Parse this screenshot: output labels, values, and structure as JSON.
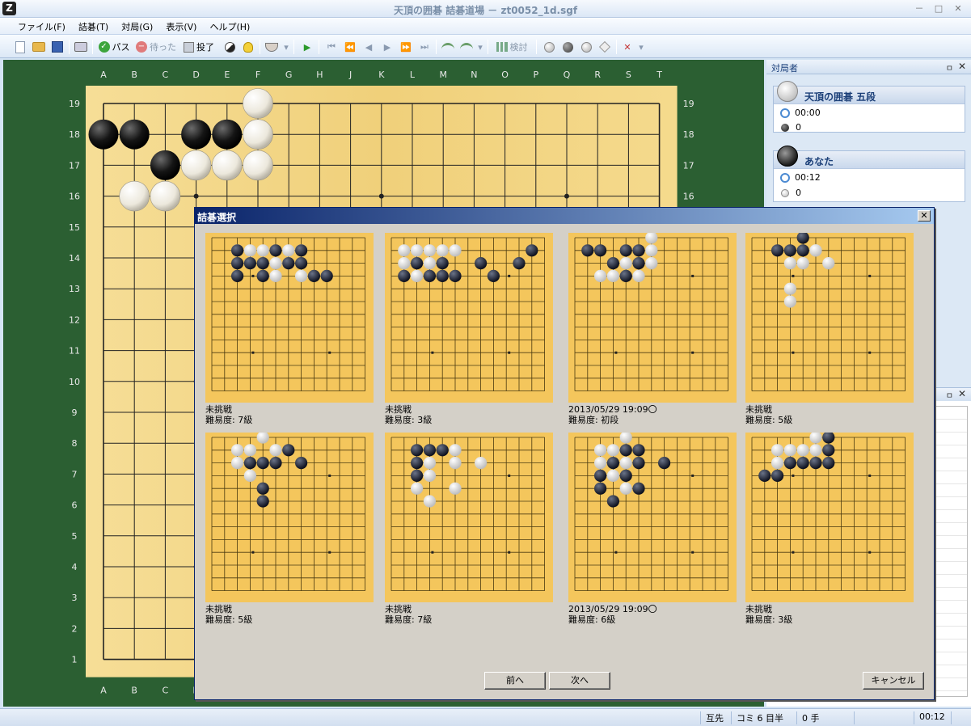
{
  "window": {
    "app_icon_label": "Z",
    "title": "天頂の囲碁 詰碁道場 － zt0052_1d.sgf",
    "minimize": "－",
    "maximize": "□",
    "close": "✕"
  },
  "menu": [
    "ファイル(F)",
    "詰碁(T)",
    "対局(G)",
    "表示(V)",
    "ヘルプ(H)"
  ],
  "toolbar": {
    "pass_label": "パス",
    "undo_label": "待った",
    "resign_label": "投了",
    "review_label": "検討",
    "play_glyph": "▶",
    "first_glyph": "⏮",
    "rewind_glyph": "⏪",
    "prev_glyph": "◀",
    "next_glyph": "▶",
    "ffwd_glyph": "⏩",
    "last_glyph": "⏭",
    "delete_glyph": "✕",
    "overflow_glyph": "▾"
  },
  "board": {
    "size": 19,
    "column_labels": [
      "A",
      "B",
      "C",
      "D",
      "E",
      "F",
      "G",
      "H",
      "J",
      "K",
      "L",
      "M",
      "N",
      "O",
      "P",
      "Q",
      "R",
      "S",
      "T"
    ],
    "row_labels": [
      "19",
      "18",
      "17",
      "16",
      "15",
      "14",
      "13",
      "12",
      "11",
      "10",
      "9",
      "8",
      "7",
      "6",
      "5",
      "4",
      "3",
      "2",
      "1"
    ],
    "background": "#2b5f32",
    "wood": "#f2d57e",
    "black_stones": [
      "A18",
      "B18",
      "D18",
      "E18",
      "C17"
    ],
    "white_stones": [
      "F19",
      "F18",
      "D17",
      "E17",
      "F17",
      "B16",
      "C16"
    ]
  },
  "players_panel": {
    "title": "対局者",
    "pin": "ㅁ",
    "close": "✕",
    "white": {
      "name": "天頂の囲碁 五段",
      "time": "00:00",
      "captures": "0"
    },
    "black": {
      "name": "あなた",
      "time": "00:12",
      "captures": "0"
    }
  },
  "dialog": {
    "title": "詰碁選択",
    "close": "✕",
    "prev_button": "前へ",
    "next_button": "次へ",
    "cancel_button": "キャンセル",
    "problems": [
      {
        "line1": "未挑戦",
        "line2": "難易度: 7級",
        "black": [
          [
            1,
            1
          ],
          [
            2,
            1
          ],
          [
            3,
            1
          ],
          [
            5,
            1
          ],
          [
            6,
            1
          ],
          [
            1,
            2
          ],
          [
            3,
            2
          ],
          [
            7,
            2
          ],
          [
            8,
            2
          ],
          [
            1,
            0
          ],
          [
            4,
            0
          ],
          [
            6,
            0
          ]
        ],
        "white": [
          [
            1,
            0
          ],
          [
            2,
            0
          ],
          [
            3,
            0
          ],
          [
            5,
            0
          ],
          [
            6,
            0
          ],
          [
            2,
            1
          ],
          [
            4,
            1
          ],
          [
            5,
            1
          ],
          [
            4,
            2
          ],
          [
            6,
            2
          ]
        ]
      },
      {
        "line1": "未挑戦",
        "line2": "難易度: 3級",
        "black": [
          [
            2,
            2
          ],
          [
            3,
            2
          ],
          [
            4,
            2
          ],
          [
            1,
            1
          ],
          [
            3,
            1
          ],
          [
            6,
            1
          ],
          [
            7,
            2
          ],
          [
            9,
            1
          ],
          [
            10,
            0
          ],
          [
            0,
            2
          ]
        ],
        "white": [
          [
            0,
            0
          ],
          [
            1,
            0
          ],
          [
            2,
            0
          ],
          [
            3,
            0
          ],
          [
            4,
            0
          ],
          [
            2,
            1
          ],
          [
            1,
            2
          ],
          [
            0,
            1
          ]
        ]
      },
      {
        "line1": "2013/05/29 19:09〇",
        "line2": "難易度: 初段",
        "black": [
          [
            0,
            0
          ],
          [
            1,
            0
          ],
          [
            3,
            0
          ],
          [
            4,
            0
          ],
          [
            2,
            1
          ],
          [
            4,
            1
          ],
          [
            3,
            2
          ]
        ],
        "white": [
          [
            5,
            -1
          ],
          [
            5,
            0
          ],
          [
            3,
            1
          ],
          [
            5,
            1
          ],
          [
            2,
            2
          ],
          [
            4,
            2
          ],
          [
            1,
            2
          ]
        ]
      },
      {
        "line1": "未挑戦",
        "line2": "難易度: 5級",
        "black": [
          [
            3,
            -1
          ],
          [
            1,
            0
          ],
          [
            2,
            0
          ],
          [
            3,
            0
          ]
        ],
        "white": [
          [
            4,
            0
          ],
          [
            2,
            1
          ],
          [
            3,
            1
          ],
          [
            5,
            1
          ],
          [
            2,
            3
          ],
          [
            2,
            4
          ],
          [
            4,
            0
          ]
        ]
      },
      {
        "line1": "未挑戦",
        "line2": "難易度: 5級",
        "black": [
          [
            2,
            1
          ],
          [
            3,
            1
          ],
          [
            4,
            1
          ],
          [
            5,
            0
          ],
          [
            6,
            1
          ],
          [
            3,
            3
          ],
          [
            3,
            4
          ]
        ],
        "white": [
          [
            3,
            -1
          ],
          [
            1,
            0
          ],
          [
            2,
            0
          ],
          [
            4,
            0
          ],
          [
            1,
            1
          ],
          [
            2,
            2
          ]
        ]
      },
      {
        "line1": "未挑戦",
        "line2": "難易度: 7級",
        "black": [
          [
            1,
            0
          ],
          [
            2,
            0
          ],
          [
            3,
            0
          ],
          [
            1,
            1
          ],
          [
            1,
            2
          ]
        ],
        "white": [
          [
            4,
            0
          ],
          [
            2,
            1
          ],
          [
            4,
            1
          ],
          [
            6,
            1
          ],
          [
            2,
            2
          ],
          [
            1,
            3
          ],
          [
            4,
            3
          ],
          [
            2,
            4
          ]
        ]
      },
      {
        "line1": "2013/05/29 19:09〇",
        "line2": "難易度: 6級",
        "black": [
          [
            3,
            0
          ],
          [
            4,
            0
          ],
          [
            2,
            1
          ],
          [
            4,
            1
          ],
          [
            1,
            2
          ],
          [
            3,
            2
          ],
          [
            4,
            3
          ],
          [
            1,
            3
          ],
          [
            2,
            4
          ],
          [
            6,
            1
          ]
        ],
        "white": [
          [
            3,
            -1
          ],
          [
            1,
            0
          ],
          [
            2,
            0
          ],
          [
            1,
            1
          ],
          [
            3,
            1
          ],
          [
            1,
            2
          ],
          [
            2,
            2
          ],
          [
            3,
            3
          ]
        ]
      },
      {
        "line1": "未挑戦",
        "line2": "難易度: 3級",
        "black": [
          [
            5,
            -1
          ],
          [
            5,
            0
          ],
          [
            2,
            1
          ],
          [
            3,
            1
          ],
          [
            4,
            1
          ],
          [
            5,
            1
          ],
          [
            1,
            2
          ],
          [
            0,
            2
          ]
        ],
        "white": [
          [
            4,
            -1
          ],
          [
            1,
            0
          ],
          [
            2,
            0
          ],
          [
            3,
            0
          ],
          [
            4,
            0
          ],
          [
            1,
            1
          ]
        ]
      }
    ]
  },
  "status": {
    "turn": "互先",
    "komi": "コミ 6 目半",
    "moves": "0 手",
    "clock": "00:12"
  }
}
